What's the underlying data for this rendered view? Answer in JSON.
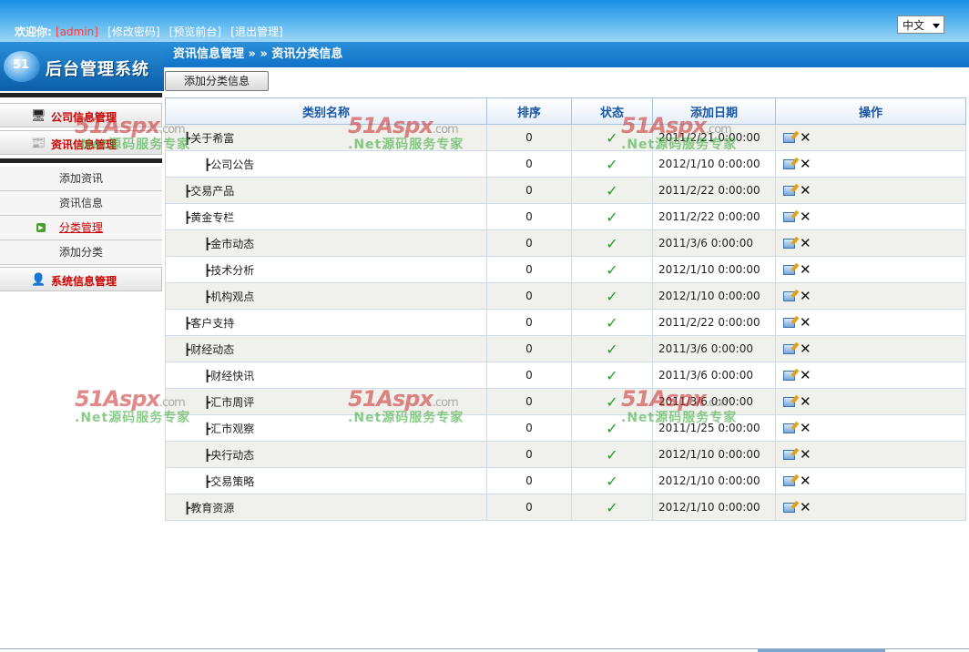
{
  "header": {
    "welcome_label": "欢迎你:",
    "username": "[admin]",
    "links": [
      "[修改密码]",
      "[预览前台]",
      "[退出管理]"
    ],
    "language": "中文"
  },
  "logo": {
    "title": "后台管理系统",
    "mark": "51"
  },
  "breadcrumb": "资讯信息管理 » » 资讯分类信息",
  "sidebar": {
    "groups": [
      {
        "label": "公司信息管理",
        "icon": "monitor-icon"
      },
      {
        "label": "资讯信息管理",
        "icon": "news-icon"
      }
    ],
    "subitems": [
      "添加资讯",
      "资讯信息",
      "分类管理",
      "添加分类"
    ],
    "active_subitem": "分类管理",
    "bottom_group": {
      "label": "系统信息管理",
      "icon": "user-icon"
    }
  },
  "toolbar": {
    "add_button": "添加分类信息"
  },
  "table": {
    "headers": [
      "类别名称",
      "排序",
      "状态",
      "添加日期",
      "操作"
    ],
    "status_glyph": "✓",
    "rows": [
      {
        "name": "┣关于希富",
        "level": 1,
        "order": "0",
        "date": "2011/2/21 0:00:00"
      },
      {
        "name": "┣公司公告",
        "level": 2,
        "order": "0",
        "date": "2012/1/10 0:00:00"
      },
      {
        "name": "┣交易产品",
        "level": 1,
        "order": "0",
        "date": "2011/2/22 0:00:00"
      },
      {
        "name": "┣黄金专栏",
        "level": 1,
        "order": "0",
        "date": "2011/2/22 0:00:00"
      },
      {
        "name": "┣金市动态",
        "level": 2,
        "order": "0",
        "date": "2011/3/6 0:00:00"
      },
      {
        "name": "┣技术分析",
        "level": 2,
        "order": "0",
        "date": "2012/1/10 0:00:00"
      },
      {
        "name": "┣机构观点",
        "level": 2,
        "order": "0",
        "date": "2012/1/10 0:00:00"
      },
      {
        "name": "┣客户支持",
        "level": 1,
        "order": "0",
        "date": "2011/2/22 0:00:00"
      },
      {
        "name": "┣财经动态",
        "level": 1,
        "order": "0",
        "date": "2011/3/6 0:00:00"
      },
      {
        "name": "┣财经快讯",
        "level": 2,
        "order": "0",
        "date": "2011/3/6 0:00:00"
      },
      {
        "name": "┣汇市周评",
        "level": 2,
        "order": "0",
        "date": "2011/3/6 0:00:00"
      },
      {
        "name": "┣汇市观察",
        "level": 2,
        "order": "0",
        "date": "2011/1/25 0:00:00"
      },
      {
        "name": "┣央行动态",
        "level": 2,
        "order": "0",
        "date": "2012/1/10 0:00:00"
      },
      {
        "name": "┣交易策略",
        "level": 2,
        "order": "0",
        "date": "2012/1/10 0:00:00"
      },
      {
        "name": "┣教育资源",
        "level": 1,
        "order": "0",
        "date": "2012/1/10 0:00:00"
      }
    ]
  },
  "watermark": {
    "brand": "51Aspx",
    "suffix": ".com",
    "tagline": ".Net源码服务专家"
  }
}
